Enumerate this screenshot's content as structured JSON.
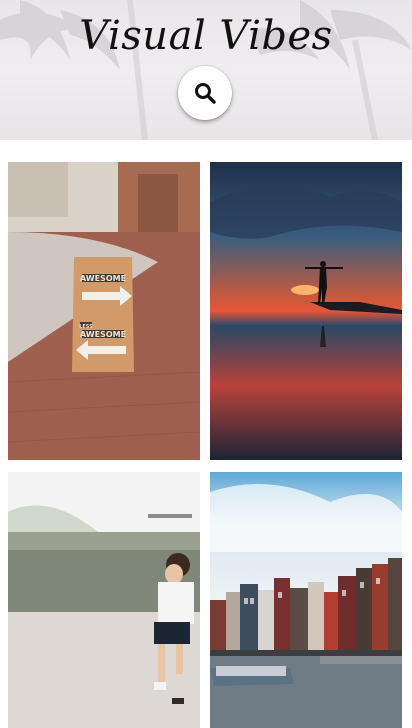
{
  "header": {
    "title": "Visual Vibes",
    "search_icon": "search-icon"
  },
  "gallery": {
    "photos": [
      {
        "subject": "sidewalk-sign-photo",
        "sign_line1": "AWESOME",
        "sign_line2": "LESS",
        "sign_line3": "AWESOME"
      },
      {
        "subject": "sunset-silhouette-photo"
      },
      {
        "subject": "child-running-photo"
      },
      {
        "subject": "canal-houses-photo"
      }
    ]
  },
  "colors": {
    "title": "#111111",
    "header_bg": "#ece9ec",
    "page_bg": "#ffffff"
  }
}
